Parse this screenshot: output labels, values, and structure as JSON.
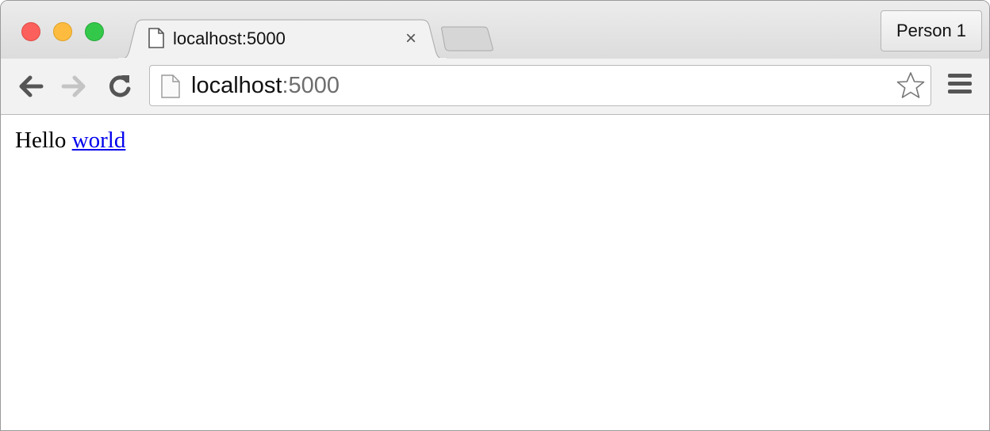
{
  "window": {
    "controls": [
      "close",
      "minimize",
      "zoom"
    ]
  },
  "tab": {
    "title": "localhost:5000",
    "icon": "document-icon",
    "close_glyph": "×"
  },
  "profile": {
    "label": "Person 1"
  },
  "toolbar": {
    "back_icon": "back-arrow-icon",
    "forward_icon": "forward-arrow-icon",
    "reload_icon": "reload-icon",
    "menu_icon": "hamburger-menu-icon",
    "star_icon": "star-icon"
  },
  "omnibox": {
    "host": "localhost",
    "port": ":5000"
  },
  "page": {
    "text": "Hello",
    "link": "world",
    "link_color": "#0000ee"
  }
}
